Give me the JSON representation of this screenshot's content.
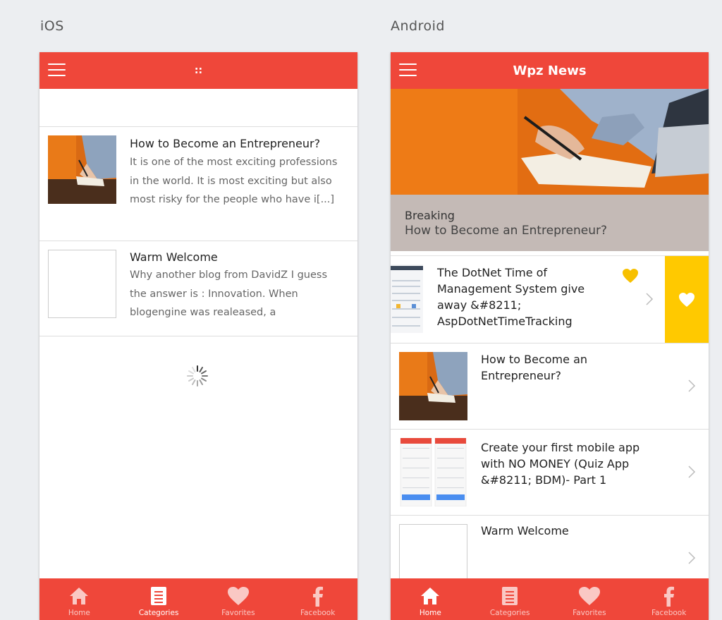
{
  "labels": {
    "ios": "iOS",
    "android": "Android"
  },
  "ios": {
    "title": "::",
    "items": [
      {
        "title": "How to Become an Entrepreneur?",
        "excerpt": "It is one of the most exciting professions in the world. It is most exciting but also most risky for the people who have i[...]"
      },
      {
        "title": "Warm Welcome",
        "excerpt": "Why another blog from DavidZ I guess the answer is : Innovation. When blogengine was realeased, a"
      }
    ]
  },
  "android": {
    "title": "Wpz News",
    "hero": {
      "tag": "Breaking",
      "title": "How to Become an Entrepreneur?"
    },
    "items": [
      {
        "title": "The DotNet Time of Management System give away &#8211; AspDotNetTimeTracking"
      },
      {
        "title": "How to Become an Entrepreneur?"
      },
      {
        "title": "Create your first mobile app with NO MONEY (Quiz App &#8211; BDM)- Part 1"
      },
      {
        "title": "Warm Welcome"
      }
    ]
  },
  "tabs": [
    "Home",
    "Categories",
    "Favorites",
    "Facebook"
  ],
  "colors": {
    "primary": "#ef473a",
    "favorite": "#ffc900",
    "background": "#eceef1"
  }
}
